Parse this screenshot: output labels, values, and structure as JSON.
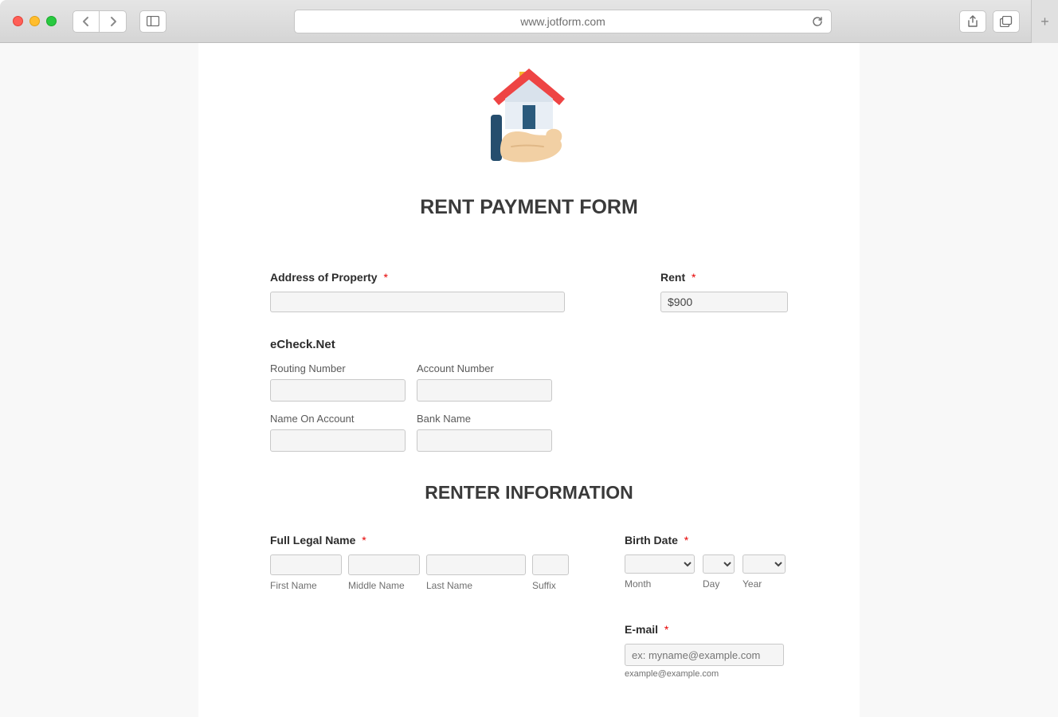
{
  "browser": {
    "url": "www.jotform.com"
  },
  "form": {
    "title": "RENT PAYMENT FORM",
    "fields": {
      "address_label": "Address of Property",
      "address_value": "",
      "rent_label": "Rent",
      "rent_value": "$900"
    },
    "echeck": {
      "section_label": "eCheck.Net",
      "routing_label": "Routing Number",
      "routing_value": "",
      "account_label": "Account Number",
      "account_value": "",
      "name_on_account_label": "Name On Account",
      "name_on_account_value": "",
      "bank_name_label": "Bank Name",
      "bank_name_value": ""
    },
    "renter_section_title": "RENTER INFORMATION",
    "name": {
      "label": "Full Legal Name",
      "first_label": "First Name",
      "first_value": "",
      "middle_label": "Middle Name",
      "middle_value": "",
      "last_label": "Last Name",
      "last_value": "",
      "suffix_label": "Suffix",
      "suffix_value": ""
    },
    "birth": {
      "label": "Birth Date",
      "month_label": "Month",
      "day_label": "Day",
      "year_label": "Year",
      "month_value": "",
      "day_value": "",
      "year_value": ""
    },
    "email": {
      "label": "E-mail",
      "placeholder": "ex: myname@example.com",
      "value": "",
      "hint": "example@example.com"
    }
  }
}
